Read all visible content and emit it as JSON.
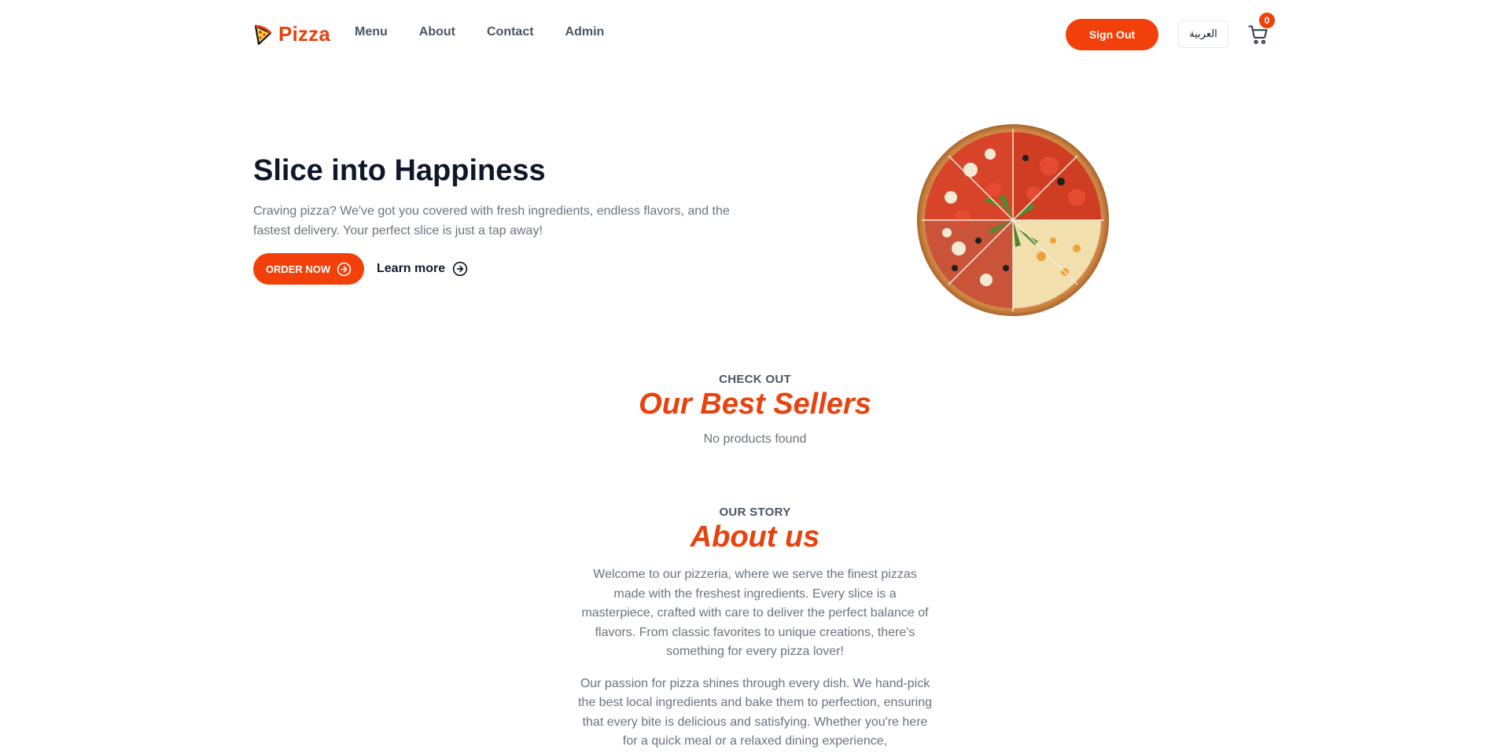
{
  "brand": {
    "name": "Pizza",
    "logo_icon": "pizza-slice-icon",
    "accent": "#e8420e",
    "button_color": "#f2400a"
  },
  "nav": {
    "items": [
      {
        "label": "Menu"
      },
      {
        "label": "About"
      },
      {
        "label": "Contact"
      },
      {
        "label": "Admin"
      }
    ]
  },
  "header": {
    "signout_label": "Sign Out",
    "language_label": "العربية",
    "cart_icon": "cart-icon",
    "cart_count": "0"
  },
  "hero": {
    "title": "Slice into Happiness",
    "description": "Craving pizza? We've got you covered with fresh ingredients, endless flavors, and the fastest delivery. Your perfect slice is just a tap away!",
    "order_label": "ORDER NOW",
    "learn_label": "Learn more",
    "order_icon": "arrow-right-circle-icon",
    "learn_icon": "arrow-right-circle-icon"
  },
  "best_sellers": {
    "eyebrow": "CHECK OUT",
    "title": "Our Best Sellers",
    "empty_message": "No products found"
  },
  "about": {
    "eyebrow": "OUR STORY",
    "title": "About us",
    "paragraphs": [
      "Welcome to our pizzeria, where we serve the finest pizzas made with the freshest ingredients. Every slice is a masterpiece, crafted with care to deliver the perfect balance of flavors. From classic favorites to unique creations, there's something for every pizza lover!",
      "Our passion for pizza shines through every dish. We hand-pick the best local ingredients and bake them to perfection, ensuring that every bite is delicious and satisfying. Whether you're here for a quick meal or a relaxed dining experience,"
    ]
  }
}
